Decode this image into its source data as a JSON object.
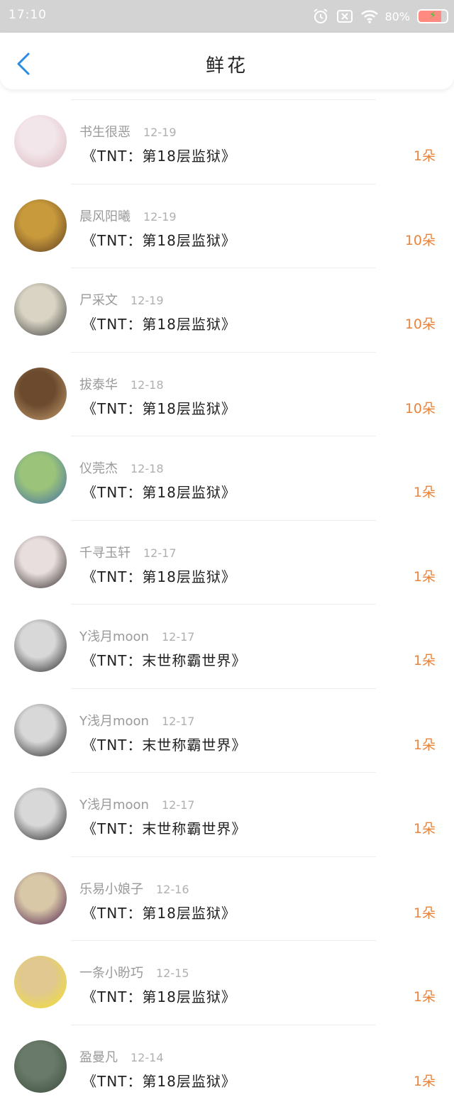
{
  "status_bar": {
    "time": "17:10",
    "battery_percent": "80%",
    "battery_level": 0.8,
    "icons": [
      "alarm-icon",
      "sim-icon",
      "wifi-icon",
      "battery-icon"
    ]
  },
  "header": {
    "title": "鲜花",
    "back_icon": "chevron-left-icon",
    "accent_color": "#2a8be6"
  },
  "list": {
    "count_color": "#e8843c",
    "items": [
      {
        "name": "书生很恶",
        "date": "12-19",
        "book": "《TNT：第18层监狱》",
        "count": "1朵"
      },
      {
        "name": "晨风阳曦",
        "date": "12-19",
        "book": "《TNT：第18层监狱》",
        "count": "10朵"
      },
      {
        "name": "尸采文",
        "date": "12-19",
        "book": "《TNT：第18层监狱》",
        "count": "10朵"
      },
      {
        "name": "拔泰华",
        "date": "12-18",
        "book": "《TNT：第18层监狱》",
        "count": "10朵"
      },
      {
        "name": "仪莞杰",
        "date": "12-18",
        "book": "《TNT：第18层监狱》",
        "count": "1朵"
      },
      {
        "name": "千寻玉轩",
        "date": "12-17",
        "book": "《TNT：第18层监狱》",
        "count": "1朵"
      },
      {
        "name": "Y浅月moon",
        "date": "12-17",
        "book": "《TNT：末世称霸世界》",
        "count": "1朵"
      },
      {
        "name": "Y浅月moon",
        "date": "12-17",
        "book": "《TNT：末世称霸世界》",
        "count": "1朵"
      },
      {
        "name": "Y浅月moon",
        "date": "12-17",
        "book": "《TNT：末世称霸世界》",
        "count": "1朵"
      },
      {
        "name": "乐易小娘子",
        "date": "12-16",
        "book": "《TNT：第18层监狱》",
        "count": "1朵"
      },
      {
        "name": "一条小盼巧",
        "date": "12-15",
        "book": "《TNT：第18层监狱》",
        "count": "1朵"
      },
      {
        "name": "盈曼凡",
        "date": "12-14",
        "book": "《TNT：第18层监狱》",
        "count": "1朵"
      }
    ]
  }
}
